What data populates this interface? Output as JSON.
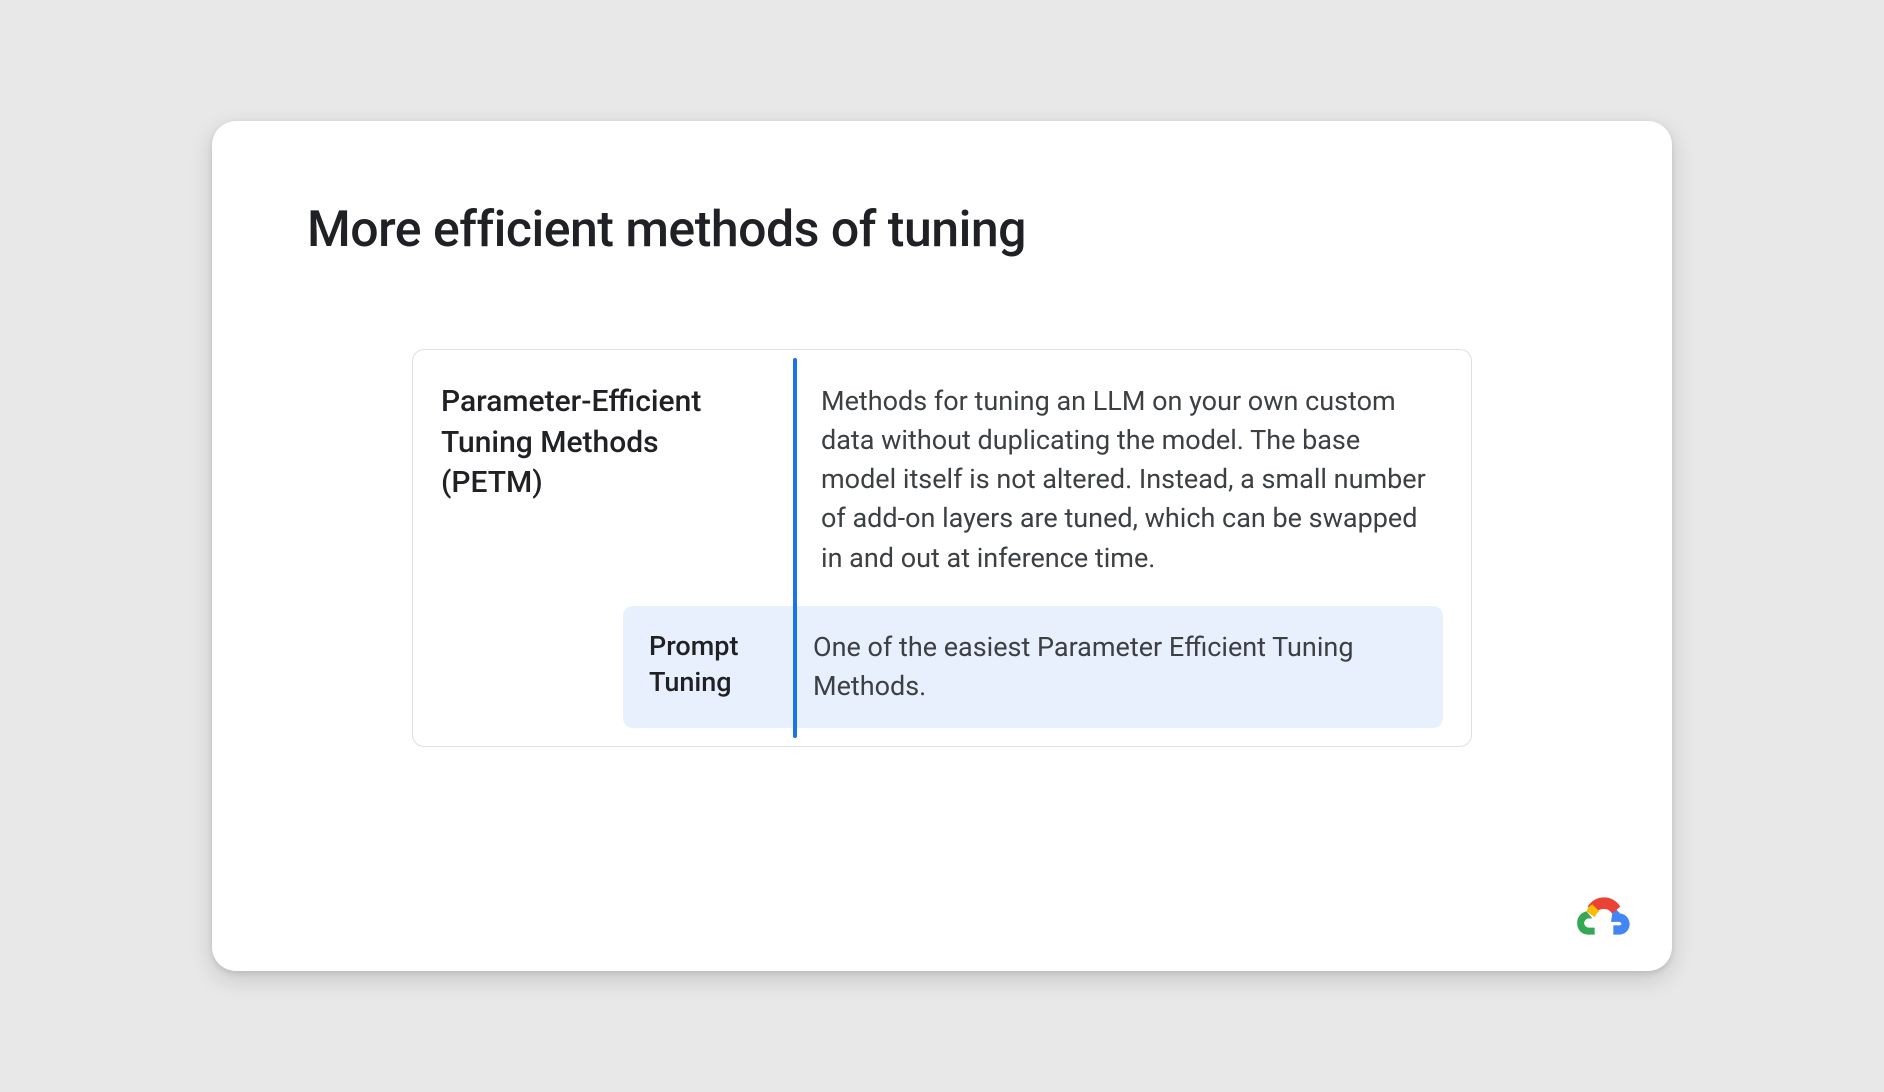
{
  "slide": {
    "title": "More efficient methods of tuning",
    "main_term": {
      "name": "Parameter-Efficient Tuning Methods (PETM)",
      "description": "Methods for tuning an LLM on your own custom data without duplicating the model. The base model itself is not altered. Instead, a small number of add-on layers are tuned, which can be swapped in and out at inference time."
    },
    "sub_term": {
      "name": "Prompt Tuning",
      "description": "One of the easiest Parameter Efficient Tuning Methods."
    }
  },
  "branding": {
    "logo_name": "google-cloud-logo"
  },
  "colors": {
    "accent": "#1a73e8",
    "highlight_bg": "#e8f0fe",
    "text_primary": "#202124",
    "text_secondary": "#3c4043"
  }
}
